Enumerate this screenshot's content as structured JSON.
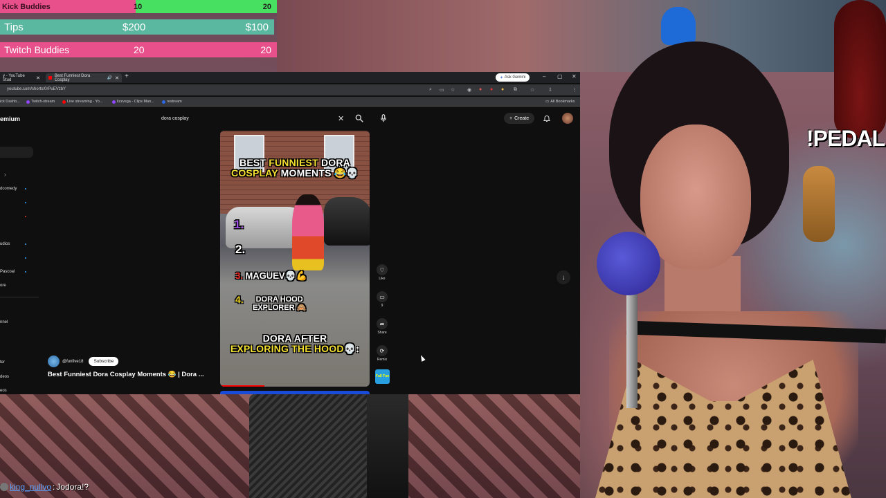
{
  "goals": {
    "kick": {
      "label": "Kick Buddies",
      "current": "10",
      "target": "20",
      "progress": 0.5
    },
    "tips": {
      "label": "Tips",
      "current": "$200",
      "target": "$100"
    },
    "twitch": {
      "label": "Twitch Buddies",
      "current": "20",
      "target": "20"
    }
  },
  "overlay_text": "!PEDAL",
  "browser": {
    "tabs": [
      {
        "label": "y - YouTube Stud",
        "active": false
      },
      {
        "label": "Best Funniest Dora Cosplay",
        "active": true
      }
    ],
    "new_tab": "+",
    "ask_gemini": "Ask Gemini",
    "url": "youtube.com/shorts/0rPuEVzbY",
    "bookmarks": [
      "ick Dashb...",
      "Twitch-stream",
      "Live streaming - Yo...",
      "lizzvega - Clips Man...",
      "restream"
    ],
    "all_bookmarks": "All Bookmarks",
    "window_controls": [
      "–",
      "▢",
      "✕"
    ]
  },
  "youtube": {
    "brand": "emium",
    "search_value": "dora cosplay",
    "create_label": "Create",
    "sidebar": [
      {
        "label": "dcomedy",
        "dot": true
      },
      {
        "label": "udios",
        "dot": true
      },
      {
        "label": "Pascoal",
        "dot": true
      },
      {
        "label": "ore",
        "dot": false
      },
      {
        "label": "nnel",
        "dot": false
      },
      {
        "label": "ter",
        "dot": false
      },
      {
        "label": "deos",
        "dot": false
      },
      {
        "label": "eos",
        "dot": false
      }
    ],
    "short": {
      "title_1a": "BEST ",
      "title_1b": "FUNNIEST",
      "title_1c": " DORA",
      "title_2a": "COSPLAY",
      "title_2b": " MOMENTS 😂💀",
      "item1": "1.",
      "item2": "2.",
      "item3_num": "3.",
      "item3_text": "MAGUEV💀💪",
      "item4_num": "4.",
      "item4_text_1": "DORA HOOD",
      "item4_text_2": "EXPLORER 🙈",
      "footer_1": "DORA AFTER",
      "footer_2a": "EXPLORING THE ",
      "footer_2b": "HOOD",
      "footer_2c": "💀:"
    },
    "actions": [
      {
        "label": "Like",
        "icon": "heart-icon"
      },
      {
        "label": "9",
        "icon": "comment-icon"
      },
      {
        "label": "Share",
        "icon": "share-icon"
      },
      {
        "label": "Remix",
        "icon": "remix-icon"
      }
    ],
    "remix_thumb": "Full Fun",
    "channel": "@funfive18",
    "subscribe": "Subscribe",
    "caption": "Best Funniest Dora Cosplay Moments 😂 | Dora ..."
  },
  "chat": {
    "user": "king_nullvo",
    "message": "Jodora!?"
  },
  "colors": {
    "kick_fill": "#47e060",
    "goal_pink": "#e8508c",
    "tips_green": "#5ab8a0"
  }
}
